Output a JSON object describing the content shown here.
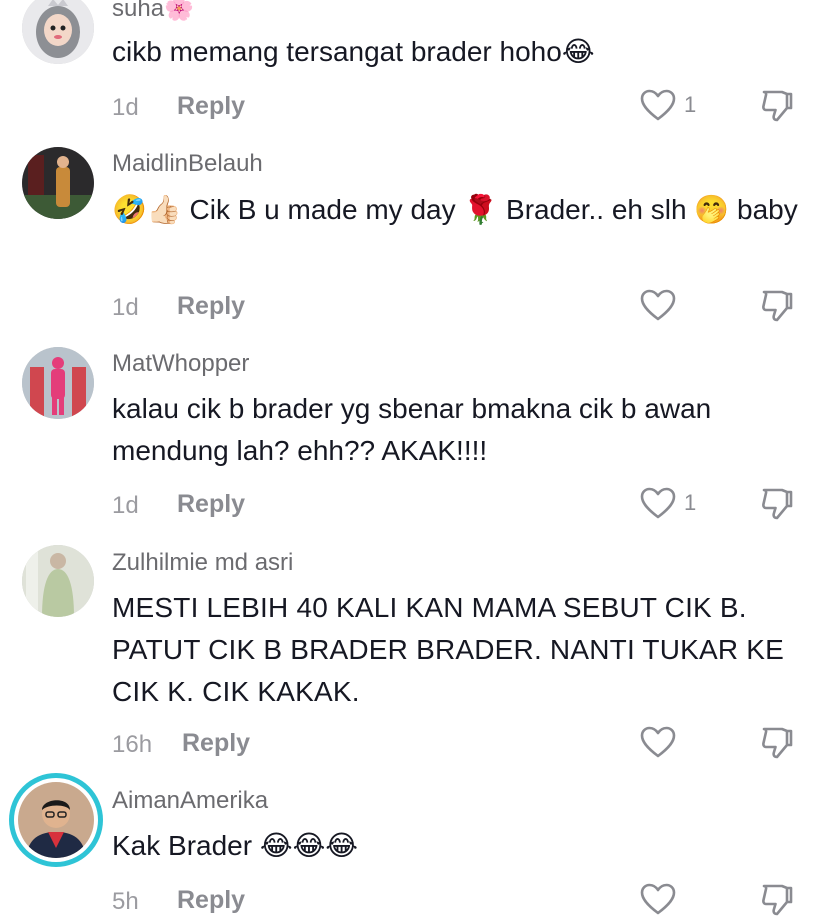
{
  "comments": [
    {
      "username": "suha🌸",
      "text": "cikb memang tersangat brader hoho😂",
      "time": "1d",
      "reply_label": "Reply",
      "likes": "1"
    },
    {
      "username": "MaidlinBelauh",
      "text": "🤣👍🏻 Cik B u made my day 🌹 Brader.. eh slh 🤭 baby",
      "time": "1d",
      "reply_label": "Reply",
      "likes": ""
    },
    {
      "username": "MatWhopper",
      "text": "kalau cik b brader yg sbenar bmakna cik b awan mendung lah? ehh?? AKAK!!!!",
      "time": "1d",
      "reply_label": "Reply",
      "likes": "1"
    },
    {
      "username": "Zulhilmie md asri",
      "text": "MESTI LEBIH 40 KALI KAN MAMA SEBUT CIK B. PATUT CIK B BRADER BRADER. NANTI TUKAR KE CIK K. CIK KAKAK.",
      "time": "16h",
      "reply_label": "Reply",
      "likes": ""
    },
    {
      "username": "AimanAmerika",
      "text": "Kak Brader 😂😂😂",
      "time": "5h",
      "reply_label": "Reply",
      "likes": ""
    }
  ],
  "icons": {
    "like": "heart-outline-icon",
    "dislike": "thumbs-down-outline-icon"
  },
  "colors": {
    "text": "#161823",
    "username": "#6b6b6f",
    "meta": "#9b9ba0",
    "avatar_ring": "#2ec4d6"
  }
}
